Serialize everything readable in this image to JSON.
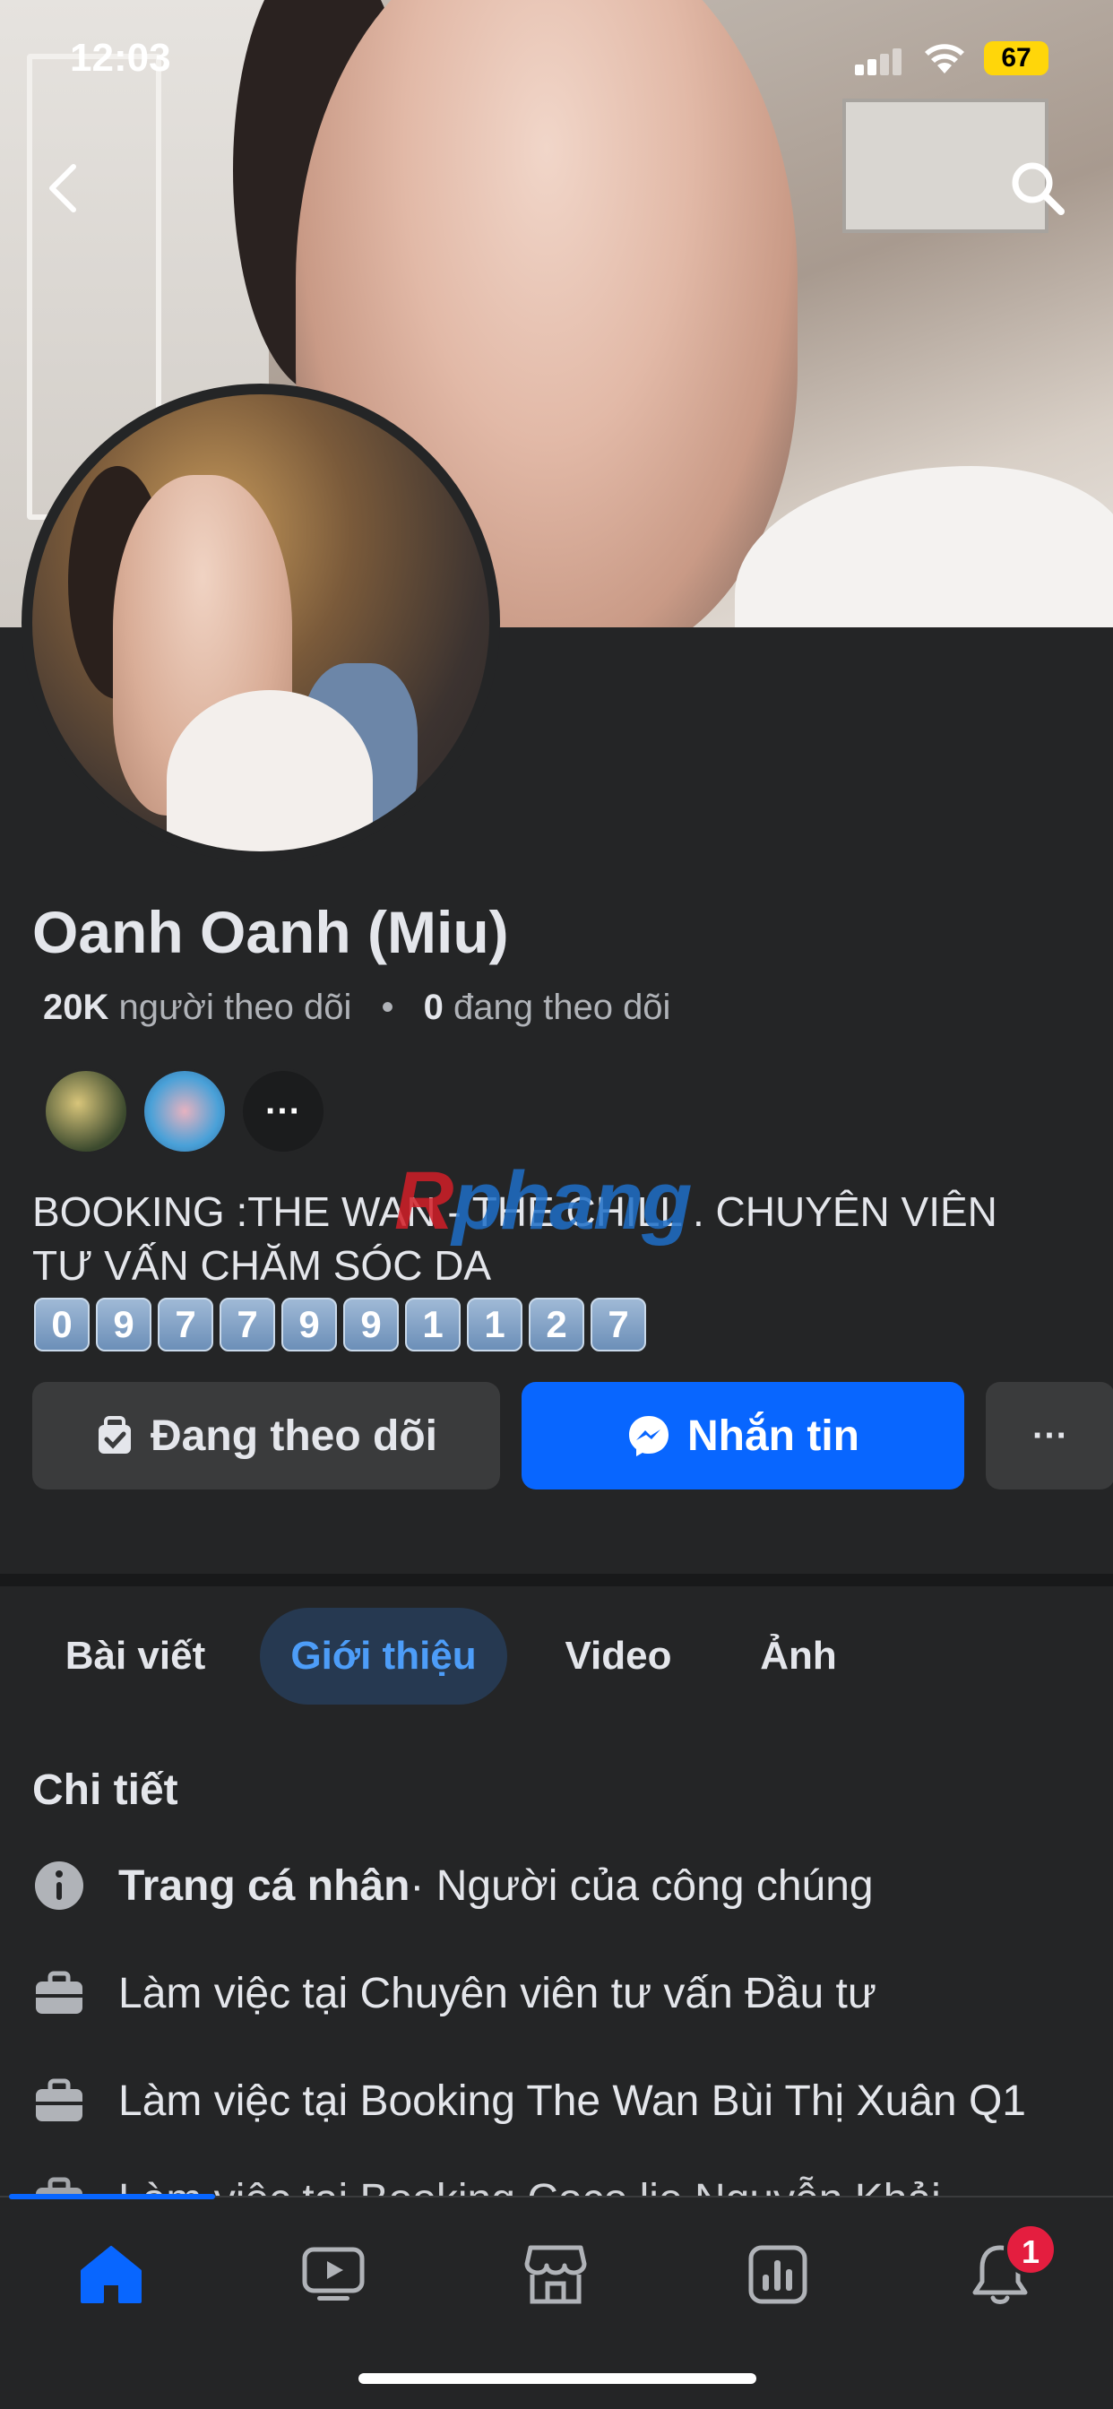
{
  "status_bar": {
    "time": "12:03",
    "battery": "67"
  },
  "profile": {
    "name": "Oanh Oanh (Miu)",
    "followers_count": "20K",
    "followers_label": "người theo dõi",
    "following_count": "0",
    "following_label": "đang theo dõi",
    "mutuals_more": "···",
    "bio_line1": "BOOKING :THE WAN - THE CHILL . CHUYÊN VIÊN",
    "bio_line2": "TƯ VẤN CHĂM SÓC DA",
    "phone_digits": [
      "0",
      "9",
      "7",
      "7",
      "9",
      "9",
      "1",
      "1",
      "2",
      "7"
    ]
  },
  "watermark": {
    "first_letter": "R",
    "rest": "phang"
  },
  "actions": {
    "following_label": "Đang theo dõi",
    "message_label": "Nhắn tin",
    "more_label": "···"
  },
  "tabs": [
    {
      "label": "Bài viết"
    },
    {
      "label": "Giới thiệu"
    },
    {
      "label": "Video"
    },
    {
      "label": "Ảnh"
    }
  ],
  "details": {
    "title": "Chi tiết",
    "items": [
      {
        "bold": "Trang cá nhân",
        "text": " · Người của công chúng",
        "icon": "info-icon"
      },
      {
        "bold": "",
        "text": "Làm việc tại Chuyên viên tư vấn Đầu tư",
        "icon": "briefcase-icon"
      },
      {
        "bold": "",
        "text": "Làm việc tại Booking The Wan Bùi Thị Xuân Q1",
        "icon": "briefcase-icon"
      },
      {
        "bold": "",
        "text": "Làm việc tại Booking Coco lie Nguyễn Khải",
        "icon": "briefcase-icon"
      }
    ]
  },
  "bottom_nav": {
    "items": [
      "home-icon",
      "video-icon",
      "marketplace-icon",
      "dashboard-icon",
      "bell-icon"
    ],
    "notification_badge": "1"
  },
  "colors": {
    "accent": "#0866ff",
    "background": "#242526",
    "tab_active_bg": "#263951",
    "badge": "#e41e3f"
  }
}
